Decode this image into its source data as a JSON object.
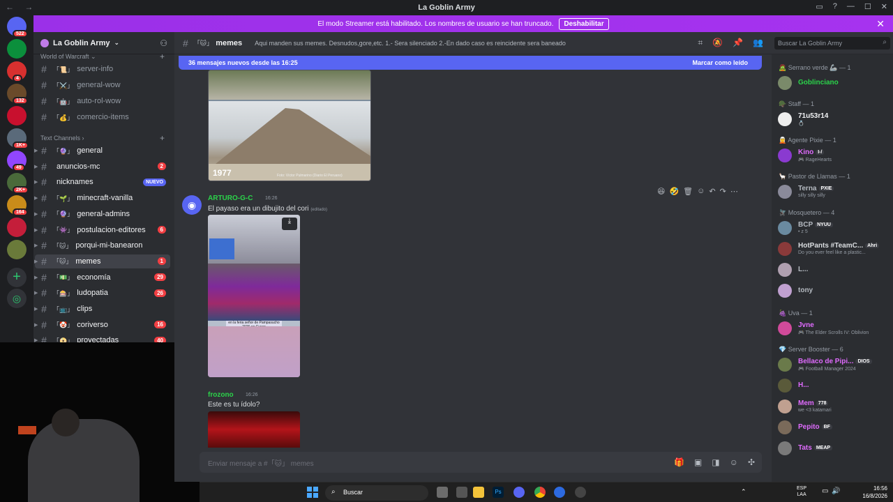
{
  "window": {
    "title": "La Goblin Army",
    "nav_glyphs": "← →"
  },
  "banner": {
    "text": "El modo Streamer está habilitado. Los nombres de usuario se han truncado.",
    "button": "Deshabilitar"
  },
  "guilds": [
    {
      "badge": "522",
      "color": "#5865f2"
    },
    {
      "badge": "",
      "color": "#0b8f3c"
    },
    {
      "badge": "4",
      "color": "#d8302f"
    },
    {
      "badge": "132",
      "color": "#6a4a2a"
    },
    {
      "badge": "",
      "color": "#c8102e"
    },
    {
      "badge": "1K+",
      "color": "#5a6a7a"
    },
    {
      "badge": "49",
      "color": "#9146ff"
    },
    {
      "badge": "2K+",
      "color": "#4a6a3a"
    },
    {
      "badge": "164",
      "color": "#c98c1a"
    },
    {
      "badge": "",
      "color": "#c41e3a"
    },
    {
      "badge": "",
      "color": "#6a7a3a"
    }
  ],
  "server": {
    "name": "La Goblin Army"
  },
  "sidebar": {
    "category_wow": "World of Warcraft",
    "wow_channels": [
      {
        "emoji": "「📜」",
        "name": "server-info"
      },
      {
        "emoji": "「⚔️」",
        "name": "general-wow"
      },
      {
        "emoji": "「🤖」",
        "name": "auto-rol-wow"
      },
      {
        "emoji": "「💰」",
        "name": "comercio-items"
      }
    ],
    "category_text": "Text Channels",
    "text_channels": [
      {
        "emoji": "「🔮」",
        "name": "general",
        "badge": ""
      },
      {
        "emoji": "",
        "name": "anuncios-mc",
        "badge": "2"
      },
      {
        "emoji": "",
        "name": "nicknames",
        "badge": "NUEVO"
      },
      {
        "emoji": "「🌱」",
        "name": "minecraft-vanilla",
        "badge": ""
      },
      {
        "emoji": "「🔮」",
        "name": "general-admins",
        "badge": ""
      },
      {
        "emoji": "「👾」",
        "name": "postulacion-editores",
        "badge": "6"
      },
      {
        "emoji": "「🐱」",
        "name": "porqui-mi-banearon",
        "badge": ""
      },
      {
        "emoji": "「🐱」",
        "name": "memes",
        "badge": "1"
      },
      {
        "emoji": "「💵」",
        "name": "economía",
        "badge": "29"
      },
      {
        "emoji": "「🎰」",
        "name": "ludopatia",
        "badge": "26"
      },
      {
        "emoji": "「📺」",
        "name": "clips",
        "badge": ""
      },
      {
        "emoji": "「🤡」",
        "name": "coriverso",
        "badge": "16"
      },
      {
        "emoji": "「📀」",
        "name": "proyectadas",
        "badge": "40"
      }
    ]
  },
  "channel_header": {
    "emoji": "「🐱」",
    "name": "memes",
    "topic": "Aqui manden sus memes. Desnudos,gore,etc. 1.- Sera silenciado 2.-En dado caso es reincidente sera baneado"
  },
  "search_placeholder": "Buscar La Goblin Army",
  "new_messages": {
    "text": "36 mensajes nuevos desde las 16:25",
    "action": "Marcar como leído"
  },
  "messages": [
    {
      "image_caption": "1977",
      "image_credit": "Foto: Víctor Pulmarino (Diario El Peruano)"
    },
    {
      "user": "ARTURO-G-C",
      "time": "16:26",
      "text": "El payaso era un dibujito del cori",
      "edited": "(editado)",
      "image_caption": "en la feria señor de Pampasucho 2026 en Cusco"
    },
    {
      "user": "frozono",
      "time": "16:26",
      "text": "Este es tu ídolo?"
    }
  ],
  "composer": {
    "placeholder": "Enviar mensaje a #「🐱」 memes"
  },
  "members": {
    "groups": [
      {
        "role": "🧟 Serrano verde 🦾 — 1",
        "users": [
          {
            "name": "Goblinciano",
            "status": "",
            "color": "#2bd34a",
            "tag": ""
          }
        ]
      },
      {
        "role": "🪖 Staff — 1",
        "users": [
          {
            "name": "71u53r14",
            "status": "💍",
            "color": "#f2f3f5",
            "tag": ""
          }
        ]
      },
      {
        "role": "🧝 Agente Pixie — 1",
        "users": [
          {
            "name": "Kino",
            "status": "🎮 RageHearts",
            "color": "#e06bff",
            "tag": "I-/"
          }
        ]
      },
      {
        "role": "🦙 Pastor de Llamas — 1",
        "users": [
          {
            "name": "Terna",
            "status": "silly silly silly",
            "color": "#b5bac1",
            "tag": "PXIE"
          }
        ]
      },
      {
        "role": "🪰 Mosquetero — 4",
        "users": [
          {
            "name": "BCP",
            "status": "• z 5",
            "color": "#b5bac1",
            "tag": "NYUU"
          },
          {
            "name": "HotPants #TeamC...",
            "status": "Do you ever feel like a plastic...",
            "color": "#dbdee1",
            "tag": "Ahri"
          },
          {
            "name": "L...",
            "status": "",
            "color": "#b5bac1",
            "tag": ""
          },
          {
            "name": "tony",
            "status": "",
            "color": "#b5bac1",
            "tag": ""
          }
        ]
      },
      {
        "role": "🍇 Uva — 1",
        "users": [
          {
            "name": "Jvne",
            "status": "🎮 The Elder Scrolls IV: Oblivion",
            "color": "#e06bff",
            "tag": ""
          }
        ]
      },
      {
        "role": "💎 Server Booster — 6",
        "users": [
          {
            "name": "Bellaco de Pipi...",
            "status": "🎮 Football Manager 2024",
            "color": "#e06bff",
            "tag": "DIOS"
          },
          {
            "name": "H...",
            "status": "",
            "color": "#e06bff",
            "tag": ""
          },
          {
            "name": "Mem",
            "status": "we <3 katamari",
            "color": "#e06bff",
            "tag": "778"
          },
          {
            "name": "Pepito",
            "status": "",
            "color": "#e06bff",
            "tag": "BF"
          },
          {
            "name": "Tats",
            "status": "",
            "color": "#e06bff",
            "tag": "MEAP"
          }
        ]
      }
    ]
  },
  "taskbar": {
    "search": "Buscar",
    "lang_top": "ESP",
    "lang_bottom": "LAA",
    "time": "16:56",
    "date": "16/8/2026"
  },
  "colors": {
    "banner": "#a633ef",
    "accent": "#5865f2",
    "unread_badge": "#f23f43",
    "username_green": "#2bd34a",
    "username_purple": "#e06bff"
  }
}
